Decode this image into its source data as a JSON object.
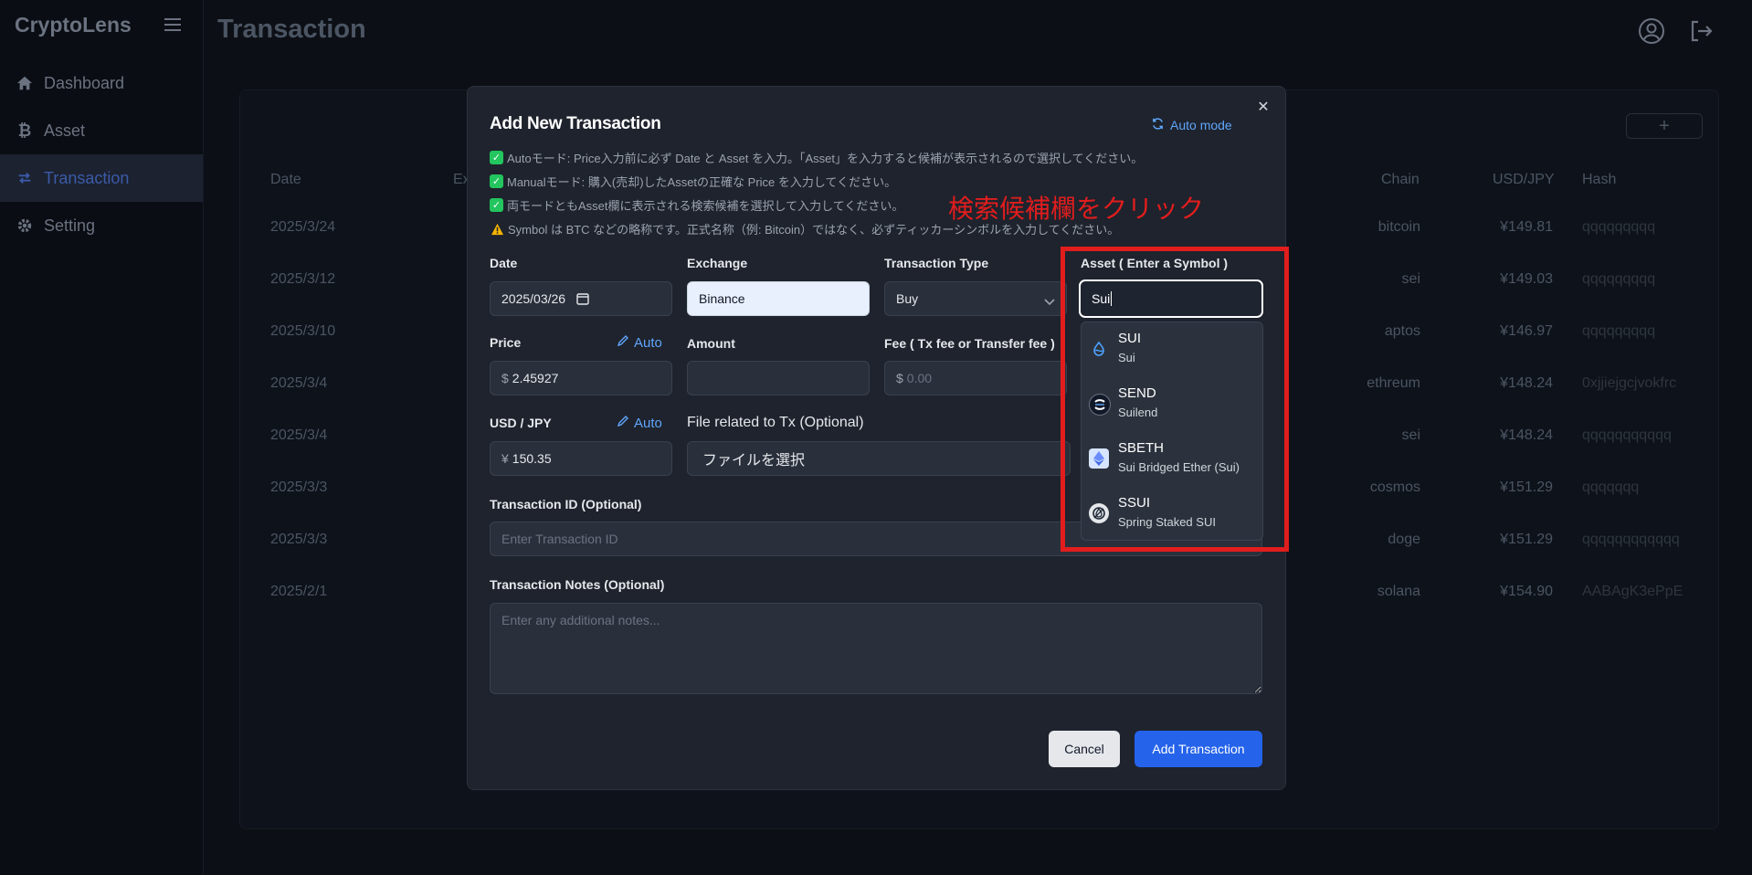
{
  "sidebar": {
    "brand": "CryptoLens",
    "items": [
      {
        "label": "Dashboard",
        "icon": "home-icon"
      },
      {
        "label": "Asset",
        "icon": "bitcoin-icon"
      },
      {
        "label": "Transaction",
        "icon": "exchange-icon",
        "active": true
      },
      {
        "label": "Setting",
        "icon": "gear-icon"
      }
    ]
  },
  "header": {
    "title": "Transaction"
  },
  "table": {
    "columns": [
      "Date",
      "Ex",
      "Chain",
      "USD/JPY",
      "Hash"
    ],
    "rows": [
      {
        "date": "2025/3/24",
        "chain": "bitcoin",
        "usdjpy": "¥149.81",
        "hash": "qqqqqqqqq"
      },
      {
        "date": "2025/3/12",
        "chain": "sei",
        "usdjpy": "¥149.03",
        "hash": "qqqqqqqqq"
      },
      {
        "date": "2025/3/10",
        "chain": "aptos",
        "usdjpy": "¥146.97",
        "hash": "qqqqqqqqq"
      },
      {
        "date": "2025/3/4",
        "chain": "ethreum",
        "usdjpy": "¥148.24",
        "hash": "0xjjiejgcjvokfrc"
      },
      {
        "date": "2025/3/4",
        "chain": "sei",
        "usdjpy": "¥148.24",
        "hash": "qqqqqqqqqqq"
      },
      {
        "date": "2025/3/3",
        "chain": "cosmos",
        "usdjpy": "¥151.29",
        "hash": "qqqqqqq"
      },
      {
        "date": "2025/3/3",
        "chain": "doge",
        "usdjpy": "¥151.29",
        "hash": "qqqqqqqqqqqq"
      },
      {
        "date": "2025/2/1",
        "chain": "solana",
        "usdjpy": "¥154.90",
        "hash": "AABAgK3ePpE"
      }
    ]
  },
  "modal": {
    "title": "Add New Transaction",
    "auto_mode_label": "Auto mode",
    "notes": [
      "Autoモード: Price入力前に必ず Date と Asset を入力。「Asset」を入力すると候補が表示されるので選択してください。",
      "Manualモード: 購入(売却)したAssetの正確な Price を入力してください。",
      "両モードともAsset欄に表示される検索候補を選択して入力してください。",
      "Symbol は BTC などの略称です。正式名称（例: Bitcoin）ではなく、必ずティッカーシンボルを入力してください。"
    ],
    "date": {
      "label": "Date",
      "value": "2025/03/26"
    },
    "exchange": {
      "label": "Exchange",
      "value": "Binance"
    },
    "tx_type": {
      "label": "Transaction Type",
      "value": "Buy"
    },
    "asset": {
      "label": "Asset ( Enter a Symbol )",
      "value": "Sui"
    },
    "price": {
      "label": "Price",
      "auto": "Auto",
      "prefix": "$",
      "value": "2.45927"
    },
    "amount": {
      "label": "Amount",
      "value": ""
    },
    "fee": {
      "label": "Fee ( Tx fee or Transfer fee )",
      "prefix": "$",
      "placeholder": "0.00"
    },
    "usdjpy": {
      "label": "USD / JPY",
      "auto": "Auto",
      "prefix": "¥",
      "value": "150.35"
    },
    "file": {
      "label": "File related to Tx (Optional)",
      "button": "ファイルを選択"
    },
    "txid": {
      "label": "Transaction ID (Optional)",
      "placeholder": "Enter Transaction ID"
    },
    "txnotes": {
      "label": "Transaction Notes (Optional)",
      "placeholder": "Enter any additional notes..."
    },
    "cancel": "Cancel",
    "submit": "Add Transaction"
  },
  "suggestions": [
    {
      "symbol": "SUI",
      "name": "Sui",
      "icon": "sui-icon"
    },
    {
      "symbol": "SEND",
      "name": "Suilend",
      "icon": "suilend-icon"
    },
    {
      "symbol": "SBETH",
      "name": "Sui Bridged Ether (Sui)",
      "icon": "ether-icon"
    },
    {
      "symbol": "SSUI",
      "name": "Spring Staked SUI",
      "icon": "spring-sui-icon"
    }
  ],
  "annotation": "検索候補欄をクリック",
  "colors": {
    "accent": "#2563eb",
    "link": "#60a5fa",
    "highlight": "#e11d1d",
    "check": "#22c55e"
  }
}
